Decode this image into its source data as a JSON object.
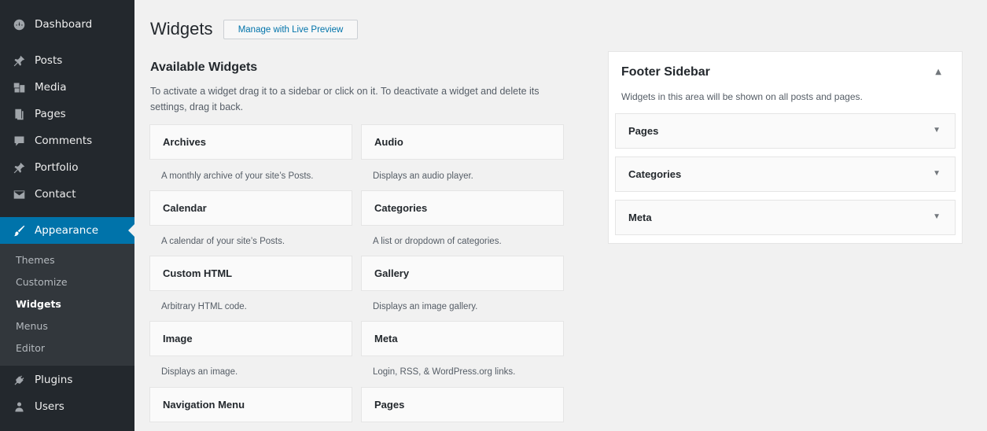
{
  "menu": {
    "dashboard": "Dashboard",
    "posts": "Posts",
    "media": "Media",
    "pages": "Pages",
    "comments": "Comments",
    "portfolio": "Portfolio",
    "contact": "Contact",
    "appearance": "Appearance",
    "plugins": "Plugins",
    "users": "Users"
  },
  "submenu": {
    "themes": "Themes",
    "customize": "Customize",
    "widgets": "Widgets",
    "menus": "Menus",
    "editor": "Editor"
  },
  "header": {
    "title": "Widgets",
    "action": "Manage with Live Preview"
  },
  "available": {
    "title": "Available Widgets",
    "description": "To activate a widget drag it to a sidebar or click on it. To deactivate a widget and delete its settings, drag it back.",
    "widgets": [
      {
        "name": "Archives",
        "desc": "A monthly archive of your site’s Posts."
      },
      {
        "name": "Audio",
        "desc": "Displays an audio player."
      },
      {
        "name": "Calendar",
        "desc": "A calendar of your site’s Posts."
      },
      {
        "name": "Categories",
        "desc": "A list or dropdown of categories."
      },
      {
        "name": "Custom HTML",
        "desc": "Arbitrary HTML code."
      },
      {
        "name": "Gallery",
        "desc": "Displays an image gallery."
      },
      {
        "name": "Image",
        "desc": "Displays an image."
      },
      {
        "name": "Meta",
        "desc": "Login, RSS, & WordPress.org links."
      },
      {
        "name": "Navigation Menu",
        "desc": ""
      },
      {
        "name": "Pages",
        "desc": ""
      }
    ]
  },
  "footer_sidebar": {
    "title": "Footer Sidebar",
    "description": "Widgets in this area will be shown on all posts and pages.",
    "toggle": "▲",
    "widgets": [
      {
        "name": "Pages",
        "arrow": "▼"
      },
      {
        "name": "Categories",
        "arrow": "▼"
      },
      {
        "name": "Meta",
        "arrow": "▼"
      }
    ]
  },
  "colors": {
    "sidebar_bg": "#23282d",
    "submenu_bg": "#32373c",
    "accent": "#0073aa",
    "page_bg": "#f1f1f1"
  }
}
